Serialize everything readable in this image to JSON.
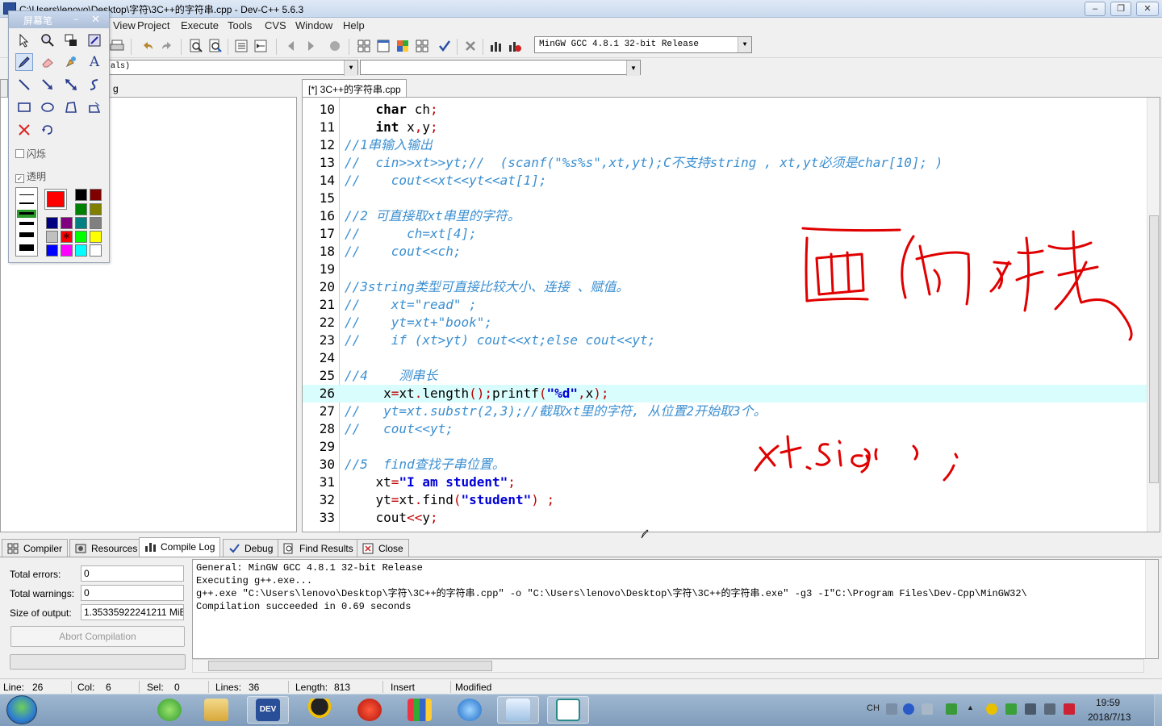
{
  "window": {
    "title": "C:\\Users\\lenovo\\Desktop\\字符\\3C++的字符串.cpp - Dev-C++ 5.6.3",
    "controls": {
      "minimize": "–",
      "maximize": "❐",
      "close": "✕"
    }
  },
  "menu": [
    "View",
    "Project",
    "Execute",
    "Tools",
    "CVS",
    "Window",
    "Help"
  ],
  "toolbar": {
    "compiler": "MinGW GCC 4.8.1 32-bit Release",
    "class_combo": "als)"
  },
  "left_panel": {
    "tab_fragment": "g"
  },
  "editor": {
    "tab_label": "[*] 3C++的字符串.cpp",
    "current_line": 26,
    "lines": [
      {
        "n": "10",
        "parts": [
          {
            "t": "    "
          },
          {
            "t": "char",
            "c": "kw"
          },
          {
            "t": " ch"
          },
          {
            "t": ";",
            "c": "sy"
          }
        ]
      },
      {
        "n": "11",
        "parts": [
          {
            "t": "    "
          },
          {
            "t": "int",
            "c": "kw"
          },
          {
            "t": " x"
          },
          {
            "t": ",",
            "c": "sy"
          },
          {
            "t": "y"
          },
          {
            "t": ";",
            "c": "sy"
          }
        ]
      },
      {
        "n": "12",
        "parts": [
          {
            "t": "//1串输入输出",
            "c": "cm"
          }
        ]
      },
      {
        "n": "13",
        "parts": [
          {
            "t": "//  cin>>xt>>yt;//  (scanf(\"%s%s\",xt,yt);C不支持string , xt,yt必须是char[10]; )",
            "c": "cm"
          }
        ]
      },
      {
        "n": "14",
        "parts": [
          {
            "t": "//    cout<<xt<<yt<<at[1];",
            "c": "cm"
          }
        ]
      },
      {
        "n": "15",
        "parts": [
          {
            "t": ""
          }
        ]
      },
      {
        "n": "16",
        "parts": [
          {
            "t": "//2 可直接取xt串里的字符。",
            "c": "cm"
          }
        ]
      },
      {
        "n": "17",
        "parts": [
          {
            "t": "//      ch=xt[4];",
            "c": "cm"
          }
        ]
      },
      {
        "n": "18",
        "parts": [
          {
            "t": "//    cout<<ch;",
            "c": "cm"
          }
        ]
      },
      {
        "n": "19",
        "parts": [
          {
            "t": ""
          }
        ]
      },
      {
        "n": "20",
        "parts": [
          {
            "t": "//3string类型可直接比较大小、连接 、赋值。",
            "c": "cm"
          }
        ]
      },
      {
        "n": "21",
        "parts": [
          {
            "t": "//    xt=\"read\" ;",
            "c": "cm"
          }
        ]
      },
      {
        "n": "22",
        "parts": [
          {
            "t": "//    yt=xt+\"book\";",
            "c": "cm"
          }
        ]
      },
      {
        "n": "23",
        "parts": [
          {
            "t": "//    if (xt>yt) cout<<xt;else cout<<yt;",
            "c": "cm"
          }
        ]
      },
      {
        "n": "24",
        "parts": [
          {
            "t": ""
          }
        ]
      },
      {
        "n": "25",
        "parts": [
          {
            "t": "//4    测串长",
            "c": "cm"
          }
        ]
      },
      {
        "n": "26",
        "parts": [
          {
            "t": "     x"
          },
          {
            "t": "=",
            "c": "sy"
          },
          {
            "t": "xt"
          },
          {
            "t": ".",
            "c": "sy"
          },
          {
            "t": "length"
          },
          {
            "t": "();",
            "c": "sy"
          },
          {
            "t": "printf"
          },
          {
            "t": "(",
            "c": "sy"
          },
          {
            "t": "\"%d\"",
            "c": "st"
          },
          {
            "t": ",",
            "c": "sy"
          },
          {
            "t": "x"
          },
          {
            "t": ");",
            "c": "sy"
          }
        ]
      },
      {
        "n": "27",
        "parts": [
          {
            "t": "//   yt=xt.substr(2,3);//截取xt里的字符, 从位置2开始取3个。",
            "c": "cm"
          }
        ]
      },
      {
        "n": "28",
        "parts": [
          {
            "t": "//   cout<<yt;",
            "c": "cm"
          }
        ]
      },
      {
        "n": "29",
        "parts": [
          {
            "t": ""
          }
        ]
      },
      {
        "n": "30",
        "parts": [
          {
            "t": "//5  find查找子串位置。",
            "c": "cm"
          }
        ]
      },
      {
        "n": "31",
        "parts": [
          {
            "t": "    xt"
          },
          {
            "t": "=",
            "c": "sy"
          },
          {
            "t": "\"I am student\"",
            "c": "st"
          },
          {
            "t": ";",
            "c": "sy"
          }
        ]
      },
      {
        "n": "32",
        "parts": [
          {
            "t": "    yt"
          },
          {
            "t": "=",
            "c": "sy"
          },
          {
            "t": "xt"
          },
          {
            "t": ".",
            "c": "sy"
          },
          {
            "t": "find"
          },
          {
            "t": "(",
            "c": "sy"
          },
          {
            "t": "\"student\"",
            "c": "st"
          },
          {
            "t": ") ;",
            "c": "sy"
          }
        ]
      },
      {
        "n": "33",
        "parts": [
          {
            "t": "    cout"
          },
          {
            "t": "<<",
            "c": "sy"
          },
          {
            "t": "y"
          },
          {
            "t": ";",
            "c": "sy"
          }
        ]
      }
    ]
  },
  "pen_palette": {
    "title": "屏幕笔",
    "flash_label": "闪烁",
    "transparent_label": "透明",
    "colors": {
      "current": "#ff0000",
      "ink": "#e00000"
    }
  },
  "bottom": {
    "tabs": [
      {
        "label": "Compiler",
        "icon": "grid-icon"
      },
      {
        "label": "Resources",
        "icon": "resources-icon"
      },
      {
        "label": "Compile Log",
        "icon": "chart-icon",
        "active": true
      },
      {
        "label": "Debug",
        "icon": "check-icon"
      },
      {
        "label": "Find Results",
        "icon": "find-icon"
      },
      {
        "label": "Close",
        "icon": "close-icon"
      }
    ],
    "total_errors_label": "Total errors:",
    "total_errors": "0",
    "total_warnings_label": "Total warnings:",
    "total_warnings": "0",
    "size_label": "Size of output:",
    "size_value": "1.35335922241211 MiB",
    "abort_label": "Abort Compilation",
    "log": [
      "General: MinGW GCC 4.8.1 32-bit Release",
      "Executing g++.exe...",
      "g++.exe \"C:\\Users\\lenovo\\Desktop\\字符\\3C++的字符串.cpp\" -o \"C:\\Users\\lenovo\\Desktop\\字符\\3C++的字符串.exe\" -g3 -I\"C:\\Program Files\\Dev-Cpp\\MinGW32\\",
      "Compilation succeeded in 0.69 seconds"
    ]
  },
  "status": {
    "line_label": "Line:",
    "line": "26",
    "col_label": "Col:",
    "col": "6",
    "sel_label": "Sel:",
    "sel": "0",
    "lines_label": "Lines:",
    "lines": "36",
    "length_label": "Length:",
    "length": "813",
    "mode": "Insert",
    "modified": "Modified"
  },
  "taskbar": {
    "lang": "CH",
    "time": "19:59",
    "date": "2018/7/13"
  }
}
